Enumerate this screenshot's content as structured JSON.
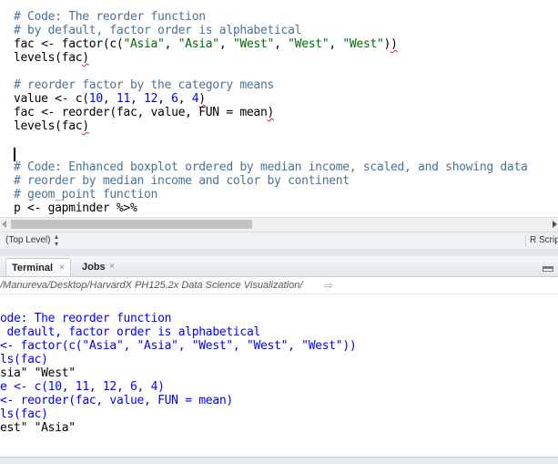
{
  "editor": {
    "lines": [
      {
        "text": "# Code: The reorder function",
        "kind": "comment"
      },
      {
        "text": "# by default, factor order is alphabetical",
        "kind": "comment"
      },
      {
        "text": "fac <- factor(c(\"Asia\", \"Asia\", \"West\", \"West\", \"West\"))",
        "kind": "code"
      },
      {
        "text": "levels(fac)",
        "kind": "code"
      },
      {
        "text": "",
        "kind": "blank"
      },
      {
        "text": "# reorder factor by the category means",
        "kind": "comment"
      },
      {
        "text": "value <- c(10, 11, 12, 6, 4)",
        "kind": "code"
      },
      {
        "text": "fac <- reorder(fac, value, FUN = mean)",
        "kind": "code"
      },
      {
        "text": "levels(fac)",
        "kind": "code"
      },
      {
        "text": "",
        "kind": "blank"
      },
      {
        "text": "",
        "kind": "cursor"
      },
      {
        "text": "# Code: Enhanced boxplot ordered by median income, scaled, and showing data",
        "kind": "comment"
      },
      {
        "text": "# reorder by median income and color by continent",
        "kind": "comment"
      },
      {
        "text": "# geom_point function",
        "kind": "comment"
      },
      {
        "text": "p <- gapminder %>%",
        "kind": "code"
      }
    ]
  },
  "statusbar": {
    "scope": "(Top Level)",
    "script_type": "R Script"
  },
  "tabs": {
    "terminal": "Terminal",
    "jobs": "Jobs",
    "close_glyph": "×"
  },
  "pathbar": {
    "path": "/Manureva/Desktop/HarvardX PH125.2x Data Science Visualization/"
  },
  "console": {
    "lines": [
      {
        "text": "ode: The reorder function",
        "kind": "input"
      },
      {
        "text": " default, factor order is alphabetical",
        "kind": "input"
      },
      {
        "text": "<- factor(c(\"Asia\", \"Asia\", \"West\", \"West\", \"West\"))",
        "kind": "input"
      },
      {
        "text": "ls(fac)",
        "kind": "input"
      },
      {
        "text": "sia\" \"West\"",
        "kind": "output"
      },
      {
        "text": "e <- c(10, 11, 12, 6, 4)",
        "kind": "input"
      },
      {
        "text": "<- reorder(fac, value, FUN = mean)",
        "kind": "input"
      },
      {
        "text": "ls(fac)",
        "kind": "input"
      },
      {
        "text": "est\" \"Asia\"",
        "kind": "output"
      }
    ]
  },
  "colors": {
    "comment": "#4b7296",
    "string": "#036a07",
    "number": "#0000ff",
    "console_input": "#0000ff",
    "console_output": "#000000"
  }
}
